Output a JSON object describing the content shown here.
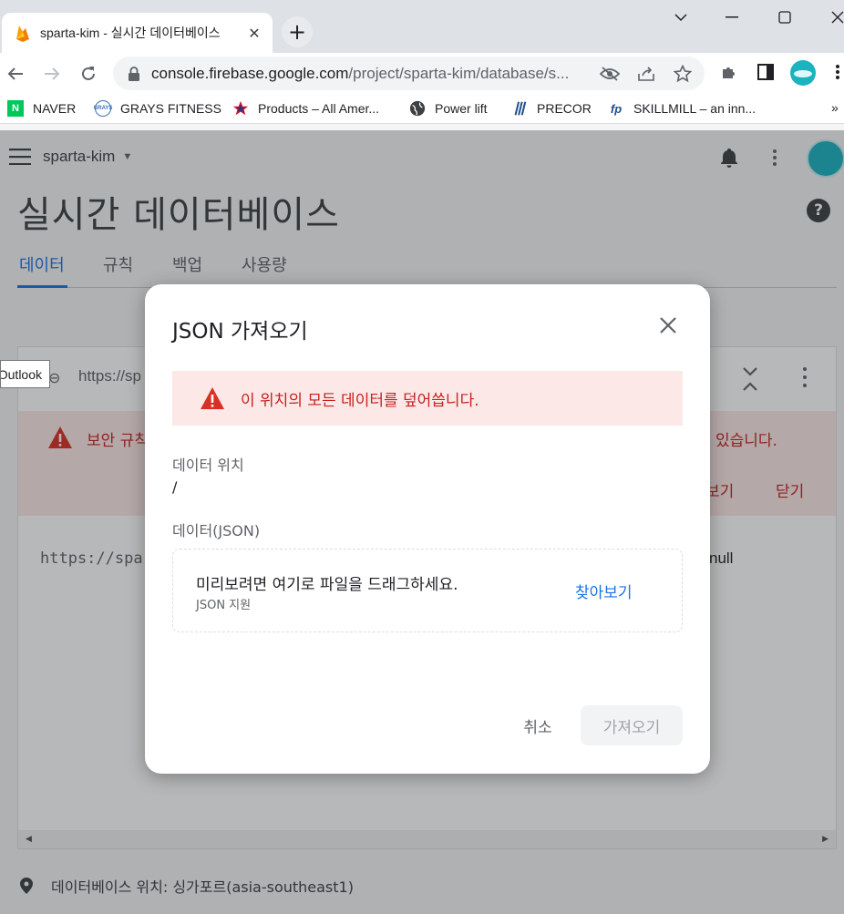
{
  "browser": {
    "tab_title": "sparta-kim - 실시간 데이터베이스",
    "url_host": "console.firebase.google.com",
    "url_path": "/project/sparta-kim/database/s...",
    "bookmarks": [
      {
        "label": "NAVER",
        "icon": "naver-icon"
      },
      {
        "label": "GRAYS FITNESS",
        "icon": "grays-fitness-icon"
      },
      {
        "label": "Products – All Amer...",
        "icon": "star-logo-icon"
      },
      {
        "label": "Power lift",
        "icon": "globe-icon"
      },
      {
        "label": "PRECOR",
        "icon": "precor-icon"
      },
      {
        "label": "SKILLMILL – an inn...",
        "icon": "fp-icon"
      }
    ],
    "bookmarks_more": "»"
  },
  "firebase": {
    "project_name": "sparta-kim",
    "page_title": "실시간 데이터베이스",
    "tabs": [
      "데이터",
      "규칙",
      "백업",
      "사용량"
    ],
    "active_tab": "데이터",
    "card_url": "https://sp",
    "warning_text": "보안 규칙",
    "warning_tail": "있습니다.",
    "warning_view": "보기",
    "warning_close": "닫기",
    "tree_root": "https://spa",
    "tree_value": "null",
    "location_text": "데이터베이스 위치: 싱가포르(asia-southeast1)"
  },
  "tooltip": "Outlook",
  "dialog": {
    "title": "JSON 가져오기",
    "warning": "이 위치의 모든 데이터를 덮어씁니다.",
    "location_label": "데이터 위치",
    "location_value": "/",
    "data_label": "데이터(JSON)",
    "drop_main": "미리보려면 여기로 파일을 드래그하세요.",
    "drop_sub": "JSON 지원",
    "browse": "찾아보기",
    "cancel": "취소",
    "import": "가져오기"
  },
  "colors": {
    "accent": "#1a73e8",
    "error": "#c5221f",
    "error_bg": "#fce8e6",
    "avatar": "#1ab3c0"
  }
}
